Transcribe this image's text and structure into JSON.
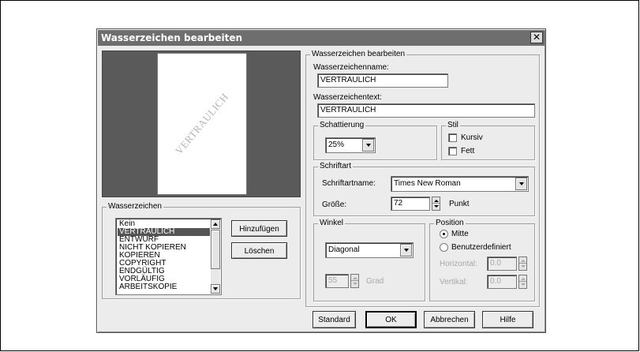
{
  "dialog": {
    "title": "Wasserzeichen bearbeiten",
    "close_glyph": "✕"
  },
  "preview": {
    "watermark_text": "VERTRAULICH"
  },
  "watermarks_group": {
    "legend": "Wasserzeichen",
    "items": [
      "Kein",
      "VERTRAULICH",
      "ENTWURF",
      "NICHT KOPIEREN",
      "KOPIEREN",
      "COPYRIGHT",
      "ENDGÜLTIG",
      "VORLÄUFIG",
      "ARBEITSKOPIE"
    ],
    "selected_index": 1,
    "add_label": "Hinzufügen",
    "delete_label": "Löschen"
  },
  "edit_group": {
    "legend": "Wasserzeichen bearbeiten",
    "name_label": "Wasserzeichenname:",
    "name_value": "VERTRAULICH",
    "text_label": "Wasserzeichentext:",
    "text_value": "VERTRAULICH"
  },
  "shading": {
    "legend": "Schattierung",
    "value": "25%"
  },
  "style": {
    "legend": "Stil",
    "italic_label": "Kursiv",
    "italic_checked": false,
    "bold_label": "Fett",
    "bold_checked": false
  },
  "font": {
    "legend": "Schriftart",
    "name_label": "Schriftartname:",
    "name_value": "Times New Roman",
    "size_label": "Größe:",
    "size_value": "72",
    "unit_label": "Punkt"
  },
  "angle": {
    "legend": "Winkel",
    "value": "Diagonal",
    "degrees_value": "55",
    "degrees_unit": "Grad"
  },
  "position": {
    "legend": "Position",
    "center_label": "Mitte",
    "center_checked": true,
    "custom_label": "Benutzerdefiniert",
    "custom_checked": false,
    "horizontal_label": "Horizontal:",
    "horizontal_value": "0.0",
    "vertical_label": "Vertikal:",
    "vertical_value": "0.0"
  },
  "buttons": {
    "standard": "Standard",
    "ok": "OK",
    "cancel": "Abbrechen",
    "help": "Hilfe"
  }
}
